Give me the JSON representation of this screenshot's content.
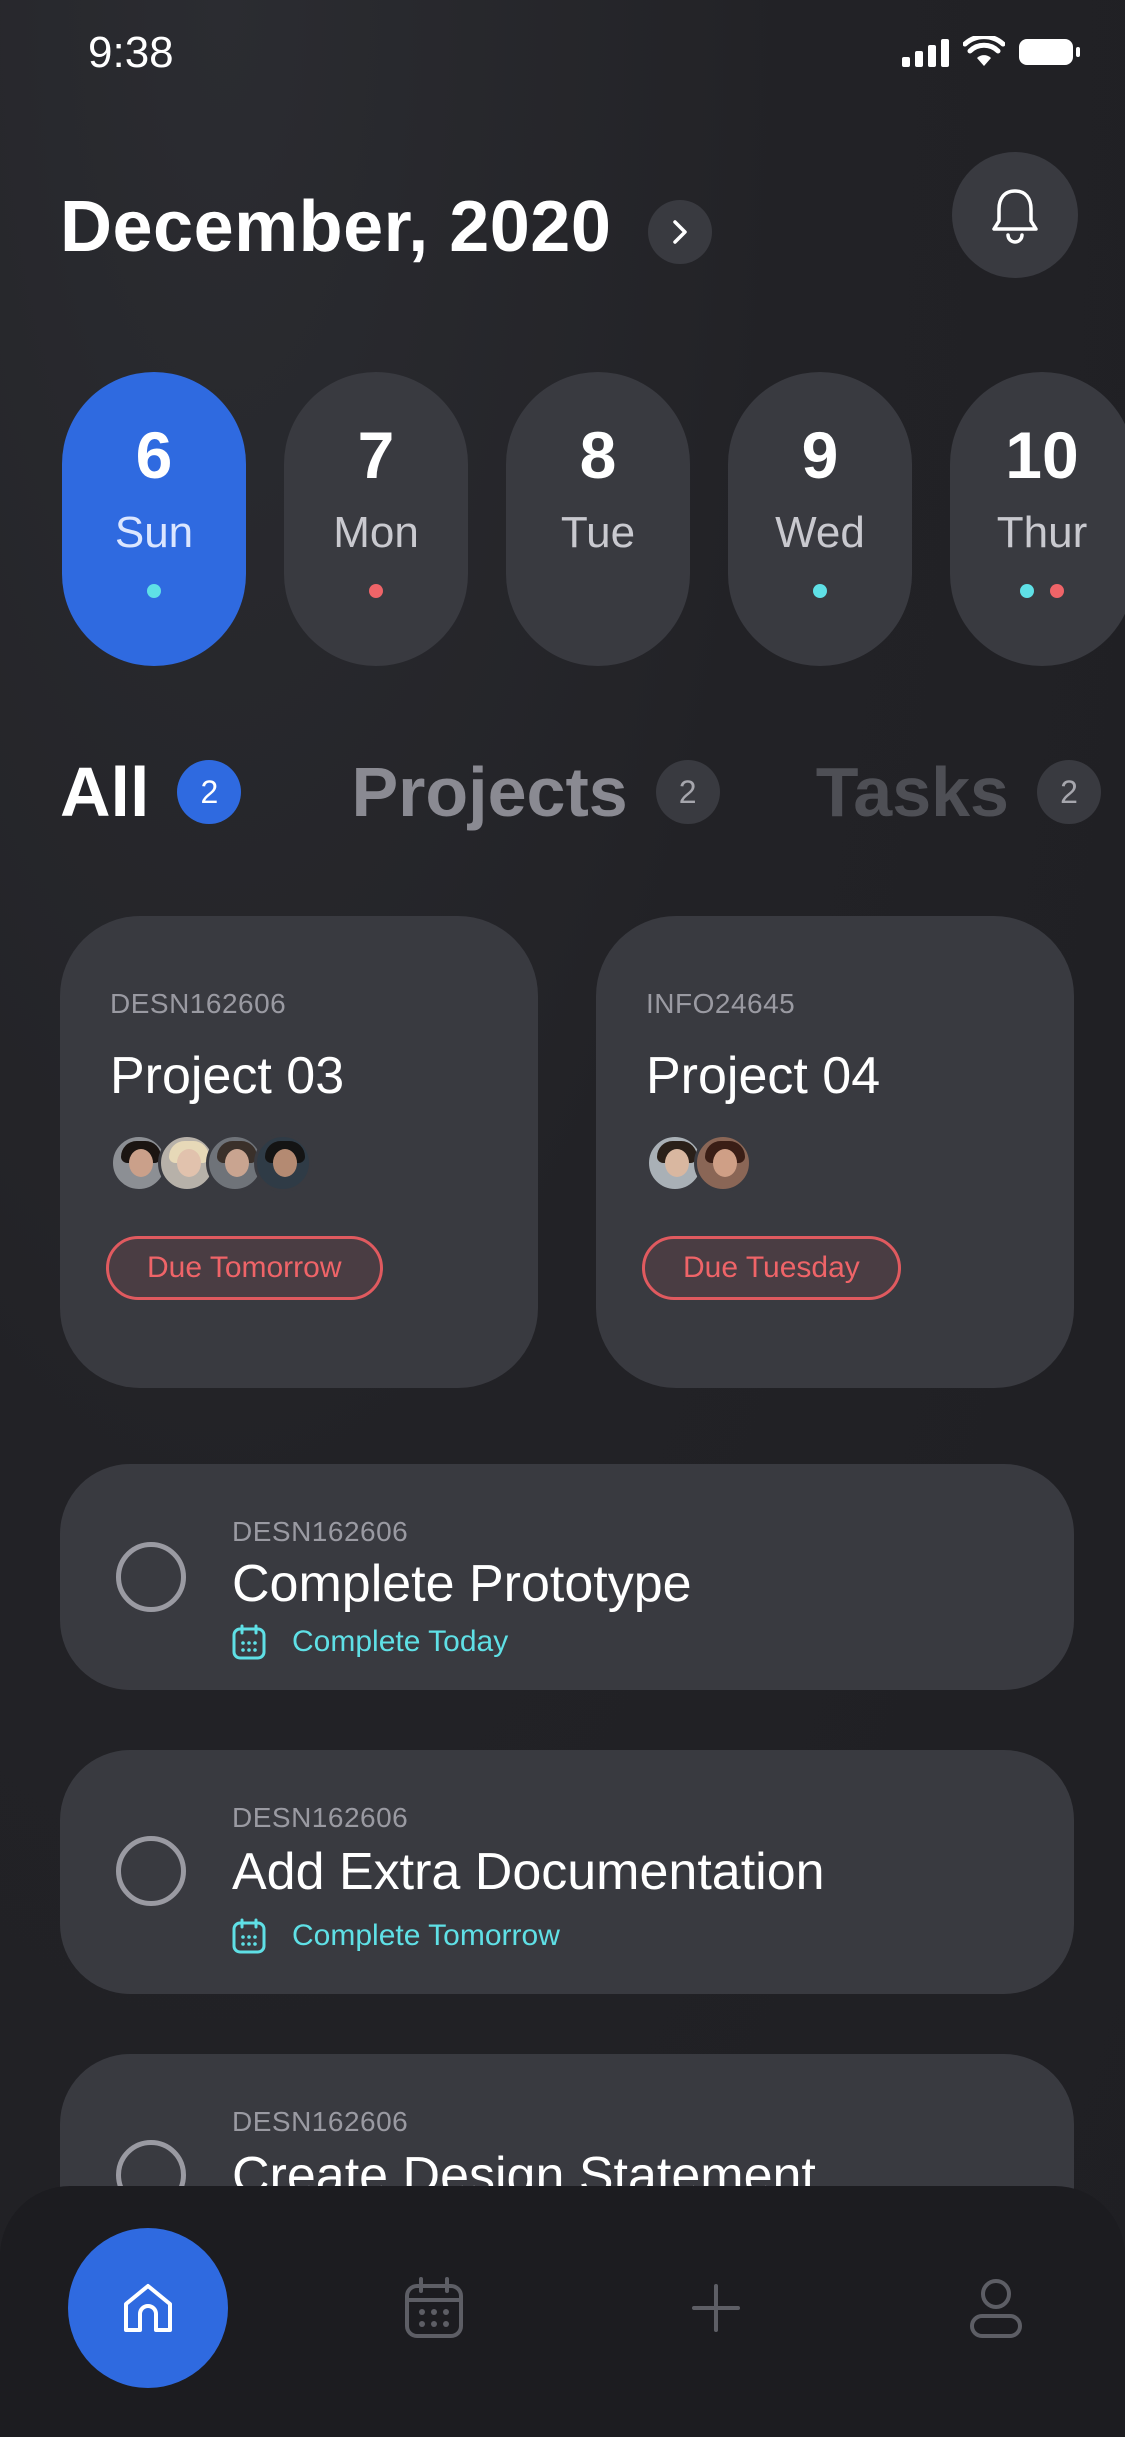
{
  "status": {
    "time": "9:38"
  },
  "header": {
    "month_title": "December, 2020"
  },
  "days": [
    {
      "num": "6",
      "name": "Sun",
      "active": true,
      "dots": [
        "#5fe0e6"
      ]
    },
    {
      "num": "7",
      "name": "Mon",
      "active": false,
      "dots": [
        "#ef6468"
      ]
    },
    {
      "num": "8",
      "name": "Tue",
      "active": false,
      "dots": []
    },
    {
      "num": "9",
      "name": "Wed",
      "active": false,
      "dots": [
        "#5fe0e6"
      ]
    },
    {
      "num": "10",
      "name": "Thur",
      "active": false,
      "dots": [
        "#5fe0e6",
        "#ef6468"
      ]
    }
  ],
  "tabs": [
    {
      "label": "All",
      "count": "2",
      "active": true
    },
    {
      "label": "Projects",
      "count": "2",
      "active": false
    },
    {
      "label": "Tasks",
      "count": "2",
      "active": false
    }
  ],
  "projects": [
    {
      "code": "DESN162606",
      "title": "Project 03",
      "due": "Due Tomorrow",
      "members": 4
    },
    {
      "code": "INFO24645",
      "title": "Project 04",
      "due": "Due Tuesday",
      "members": 2
    }
  ],
  "tasks": [
    {
      "code": "DESN162606",
      "title": "Complete Prototype",
      "due": "Complete Today"
    },
    {
      "code": "DESN162606",
      "title": "Add Extra Documentation",
      "due": "Complete  Tomorrow"
    },
    {
      "code": "DESN162606",
      "title": "Create Design Statement",
      "due": ""
    }
  ],
  "nav": [
    "home-icon",
    "calendar-icon",
    "plus-icon",
    "profile-icon"
  ],
  "colors": {
    "accent": "#2f6ae0",
    "due": "#ef6468",
    "teal": "#5fe0e6",
    "card": "#393a40",
    "background": "#212125"
  }
}
